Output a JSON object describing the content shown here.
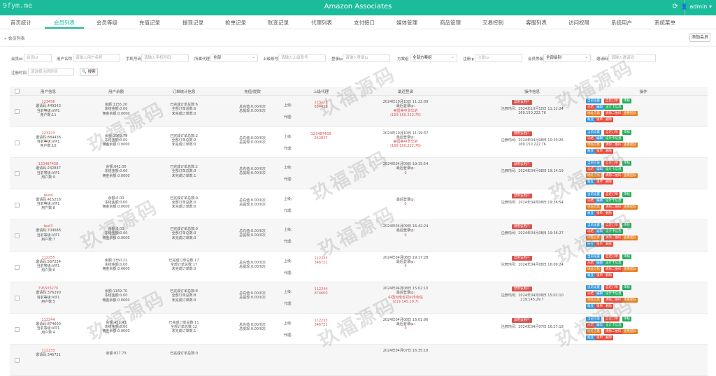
{
  "header": {
    "watermark_text": "9fym.me",
    "title": "Amazon Associates",
    "refresh_icon": "refresh-icon",
    "user_label": "admin"
  },
  "nav": {
    "items": [
      "首页统计",
      "会员列表",
      "会员等级",
      "充值记录",
      "提现记录",
      "抢单记录",
      "账变记录",
      "代理列表",
      "支付接口",
      "媒体管理",
      "商品管理",
      "交易控制",
      "客服列表",
      "访问权限",
      "系统用户",
      "系统菜单"
    ],
    "active_index": 1
  },
  "breadcrumb": "会员列表",
  "add_button": "添加会员",
  "filters": {
    "account_label": "会员id",
    "account_placeholder": "会员id",
    "username_label": "用户名称",
    "username_placeholder": "请输入用户名称",
    "phone_label": "手机号码",
    "phone_placeholder": "请输入手机号码",
    "agent_label": "所属代理",
    "agent_value": "全部",
    "superior_label": "上级账号",
    "superior_placeholder": "请输入上级账号",
    "login_label": "登录ip",
    "login_placeholder": "请输入登录ip",
    "method_label": "方案组",
    "method_value": "全部方案组",
    "register_label": "注册ip",
    "register_placeholder": "注册ip",
    "level_label": "会员等级",
    "level_value": "全部级别",
    "invite_label": "邀请码",
    "invite_placeholder": "请输入邀请码",
    "regtime_label": "注册时间",
    "regtime_placeholder": "请选择注册时间",
    "search_button": "搜索"
  },
  "table": {
    "headers": [
      "用户信息",
      "用户余额",
      "订单统计信息",
      "充值/提款",
      "上级代理",
      "最近登录",
      "操作信息",
      "操作"
    ],
    "freeze_label": "禁用该用户",
    "op_buttons": [
      [
        "当前设置",
        "自定订单",
        "审核"
      ],
      [
        "冻结",
        "编辑",
        "设计卡信息"
      ],
      [
        "地址信息",
        "清除二维码",
        "查看团队"
      ],
      [
        "账变",
        "锁单",
        "删除"
      ]
    ],
    "rows": [
      {
        "id": "123456",
        "invite": "邀请码:449243",
        "level": "当前等级:VIP1",
        "users": "用户数:11",
        "balance": "余额:1155.20",
        "frozen": "冻结金额:0.00",
        "commission": "佣金余额:0.0000",
        "orders_done": "已完成订单总数:6",
        "orders_all": "全部订单总数:6",
        "orders_pending": "未完成订单数:0",
        "recharge": "总充值:0.00/0次",
        "withdraw": "总提现:0.00/0次",
        "sup_up": "上级:",
        "sup_down": "代理:",
        "sup_id": "123123",
        "sup_code": "884438",
        "login_time": "2024年10月10日 11:22:09",
        "login_ip_label": "最后登录ip:",
        "login_loc": "美国美中罗华的",
        "login_ip": "(169.150.222.76)",
        "reg_time": "注册时间：2024年10月10日 11:12:24",
        "reg_ip": "169.150.222.76"
      },
      {
        "id": "123123",
        "invite": "邀请码:884438",
        "level": "当前等级:VIP1",
        "users": "用户数:10",
        "balance": "余额:1069.79",
        "frozen": "冻结金额:0.00",
        "commission": "佣金余额:0.0000",
        "orders_done": "已完成订单总数:2",
        "orders_all": "全部订单总数:2",
        "orders_pending": "未完成订单数:0",
        "recharge": "总充值:0.00/0次",
        "withdraw": "总提现:0.00/0次",
        "sup_up": "上级:",
        "sup_down": "代理:",
        "sup_id": "123487458",
        "sup_code": "242837",
        "login_time": "2024年10月10日 11:19:37",
        "login_ip_label": "最后登录ip:",
        "login_loc": "美国美中罗华的",
        "login_ip": "(169.150.222.76)",
        "reg_time": "注册时间：2024年04月08日 10:30:26",
        "reg_ip": "169.150.222.76"
      },
      {
        "id": "123487458",
        "invite": "邀请码:242837",
        "level": "当前等级:VIP1",
        "users": "用户数:9",
        "balance": "余额:642.00",
        "frozen": "冻结金额:0.00",
        "commission": "佣金余额:0.0000",
        "orders_done": "已完成订单总数:2",
        "orders_all": "全部订单总数:3",
        "orders_pending": "未完成订单数:1",
        "recharge": "总充值:0.00/0次",
        "withdraw": "总提现:0.00/0次",
        "sup_up": "上级:",
        "sup_down": "代理:",
        "sup_id": "",
        "sup_code": "",
        "login_time": "2024年04月09日 19:15:54",
        "login_ip_label": "最后登录ip:",
        "login_loc": "",
        "login_ip": "0",
        "reg_time": "注册时间：2024年04月08日 19:14:19",
        "reg_ip": ""
      },
      {
        "id": "test4",
        "invite": "邀请码:415218",
        "level": "当前等级:VIP1",
        "users": "用户数:8",
        "balance": "余额:0.00",
        "frozen": "冻结金额:0.00",
        "commission": "佣金余额:0.0000",
        "orders_done": "已完成订单总数:0",
        "orders_all": "全部订单总数:0",
        "orders_pending": "未完成订单数:0",
        "recharge": "总充值:0.00/0次",
        "withdraw": "总提现:0.00/0次",
        "sup_up": "上级:",
        "sup_down": "代理:",
        "sup_id": "",
        "sup_code": "",
        "login_time": "",
        "login_ip_label": "最后登录ip:",
        "login_loc": "",
        "login_ip": "0",
        "reg_time": "注册时间：2024年04月08日 19:36:54",
        "reg_ip": ""
      },
      {
        "id": "test3",
        "invite": "邀请码:709688",
        "level": "当前等级:VIP1",
        "users": "用户数:7",
        "balance": "余额:0.00",
        "frozen": "冻结金额:0.00",
        "commission": "佣金余额:0.0000",
        "orders_done": "已完成订单总数:0",
        "orders_all": "全部订单总数:0",
        "orders_pending": "未完成订单数:0",
        "recharge": "总充值:0.00/0次",
        "withdraw": "总提现:0.00/0次",
        "sup_up": "上级:",
        "sup_down": "代理:",
        "sup_id": "",
        "sup_code": "",
        "login_time": "2024年04月09日 16:42:24",
        "login_ip_label": "最后登录ip:",
        "login_loc": "",
        "login_ip": "0",
        "reg_time": "注册时间：2024年04月08日 19:36:27",
        "reg_ip": ""
      },
      {
        "id": "112255",
        "invite": "邀请码:567234",
        "level": "当前等级:VIP1",
        "users": "用户数:6",
        "balance": "余额:1350.22",
        "frozen": "冻结金额:0.00",
        "commission": "佣金余额:0.0000",
        "orders_done": "已完成订单总数:17",
        "orders_all": "全部订单总数:17",
        "orders_pending": "未完成订单数:0",
        "recharge": "总充值:0.00/0次",
        "withdraw": "总提现:0.00/0次",
        "sup_up": "上级:",
        "sup_down": "代理:",
        "sup_id": "112233",
        "sup_code": "346721",
        "login_time": "2024年04月08日 19:17:28",
        "login_ip_label": "最后登录ip:",
        "login_loc": "",
        "login_ip": "0",
        "reg_time": "注册时间：2024年04月08日 16:09:24",
        "reg_ip": ""
      },
      {
        "id": "795505270",
        "invite": "邀请码:376290",
        "level": "当前等级:VIP1",
        "users": "用户数:5",
        "balance": "余额:1169.70",
        "frozen": "冻结金额:0.00",
        "commission": "佣金余额:0.0000",
        "orders_done": "已完成订单总数:8",
        "orders_all": "全部订单总数:8",
        "orders_pending": "未完成订单数:0",
        "recharge": "总充值:0.00/0次",
        "withdraw": "总提现:0.00/0次",
        "sup_up": "上级:",
        "sup_down": "代理:",
        "sup_id": "112244",
        "sup_code": "874600",
        "login_time": "2024年04月08日 15:02:10",
        "login_ip_label": "最后登录ip:",
        "login_loc": "中国河南省郑州市电信",
        "login_ip": "(219.145.29.7)",
        "reg_time": "注册时间：2024年04月08日 15:02:10",
        "reg_ip": "219.145.29.7"
      },
      {
        "id": "112244",
        "invite": "邀请码:874600",
        "level": "当前等级:VIP1",
        "users": "用户数:4",
        "balance": "余额:451.43",
        "frozen": "冻结金额:0.00",
        "commission": "佣金余额:0.0000",
        "orders_done": "已完成订单总数:11",
        "orders_all": "全部订单总数:12",
        "orders_pending": "未完成订单数:1",
        "recharge": "总充值:0.00/0次",
        "withdraw": "总提现:0.00/0次",
        "sup_up": "上级:",
        "sup_down": "代理:",
        "sup_id": "112233",
        "sup_code": "346721",
        "login_time": "2024年04月08日 16:01:06",
        "login_ip_label": "最后登录ip:",
        "login_loc": "",
        "login_ip": "0",
        "reg_time": "注册时间：2024年04月07日 16:27:18",
        "reg_ip": ""
      },
      {
        "id": "112233",
        "invite": "邀请码:346721",
        "level": "",
        "users": "",
        "balance": "余额:827.73",
        "frozen": "",
        "commission": "",
        "orders_done": "已完成订单总数:0",
        "orders_all": "",
        "orders_pending": "",
        "recharge": "",
        "withdraw": "",
        "sup_up": "",
        "sup_down": "",
        "sup_id": "",
        "sup_code": "",
        "login_time": "2024年04月07日 16:35:18",
        "login_ip_label": "",
        "login_loc": "",
        "login_ip": "",
        "reg_time": "",
        "reg_ip": ""
      }
    ]
  },
  "watermark": "玖福源码"
}
